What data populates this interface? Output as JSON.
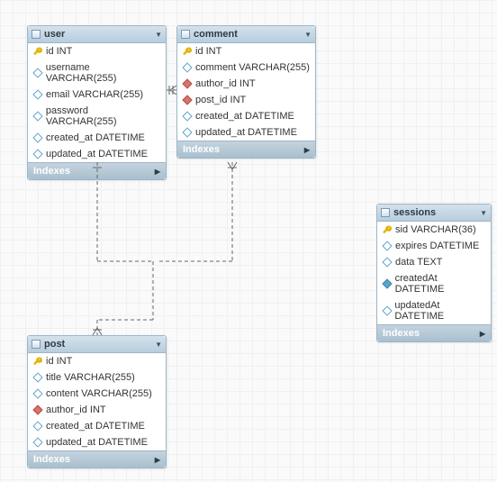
{
  "tables": {
    "user": {
      "title": "user",
      "columns": [
        {
          "icon": "key",
          "label": "id INT"
        },
        {
          "icon": "open",
          "label": "username VARCHAR(255)"
        },
        {
          "icon": "open",
          "label": "email VARCHAR(255)"
        },
        {
          "icon": "open",
          "label": "password VARCHAR(255)"
        },
        {
          "icon": "open",
          "label": "created_at DATETIME"
        },
        {
          "icon": "open",
          "label": "updated_at DATETIME"
        }
      ],
      "footer": "Indexes"
    },
    "comment": {
      "title": "comment",
      "columns": [
        {
          "icon": "key",
          "label": "id INT"
        },
        {
          "icon": "open",
          "label": "comment VARCHAR(255)"
        },
        {
          "icon": "red",
          "label": "author_id INT"
        },
        {
          "icon": "red",
          "label": "post_id INT"
        },
        {
          "icon": "open",
          "label": "created_at DATETIME"
        },
        {
          "icon": "open",
          "label": "updated_at DATETIME"
        }
      ],
      "footer": "Indexes"
    },
    "sessions": {
      "title": "sessions",
      "columns": [
        {
          "icon": "key",
          "label": "sid VARCHAR(36)"
        },
        {
          "icon": "open",
          "label": "expires DATETIME"
        },
        {
          "icon": "open",
          "label": "data TEXT"
        },
        {
          "icon": "blue",
          "label": "createdAt DATETIME"
        },
        {
          "icon": "open",
          "label": "updatedAt DATETIME"
        }
      ],
      "footer": "Indexes"
    },
    "post": {
      "title": "post",
      "columns": [
        {
          "icon": "key",
          "label": "id INT"
        },
        {
          "icon": "open",
          "label": "title VARCHAR(255)"
        },
        {
          "icon": "open",
          "label": "content VARCHAR(255)"
        },
        {
          "icon": "red",
          "label": "author_id INT"
        },
        {
          "icon": "open",
          "label": "created_at DATETIME"
        },
        {
          "icon": "open",
          "label": "updated_at DATETIME"
        }
      ],
      "footer": "Indexes"
    }
  },
  "chart_data": {
    "type": "er-diagram",
    "entities": [
      {
        "name": "user",
        "attributes": [
          "id INT (PK)",
          "username VARCHAR(255)",
          "email VARCHAR(255)",
          "password VARCHAR(255)",
          "created_at DATETIME",
          "updated_at DATETIME"
        ]
      },
      {
        "name": "comment",
        "attributes": [
          "id INT (PK)",
          "comment VARCHAR(255)",
          "author_id INT (FK)",
          "post_id INT (FK)",
          "created_at DATETIME",
          "updated_at DATETIME"
        ]
      },
      {
        "name": "post",
        "attributes": [
          "id INT (PK)",
          "title VARCHAR(255)",
          "content VARCHAR(255)",
          "author_id INT (FK)",
          "created_at DATETIME",
          "updated_at DATETIME"
        ]
      },
      {
        "name": "sessions",
        "attributes": [
          "sid VARCHAR(36) (PK)",
          "expires DATETIME",
          "data TEXT",
          "createdAt DATETIME",
          "updatedAt DATETIME"
        ]
      }
    ],
    "relationships": [
      {
        "from": "user",
        "to": "comment",
        "type": "one-to-many",
        "via": "author_id"
      },
      {
        "from": "user",
        "to": "post",
        "type": "one-to-many",
        "via": "author_id"
      },
      {
        "from": "post",
        "to": "comment",
        "type": "one-to-many",
        "via": "post_id"
      }
    ]
  }
}
